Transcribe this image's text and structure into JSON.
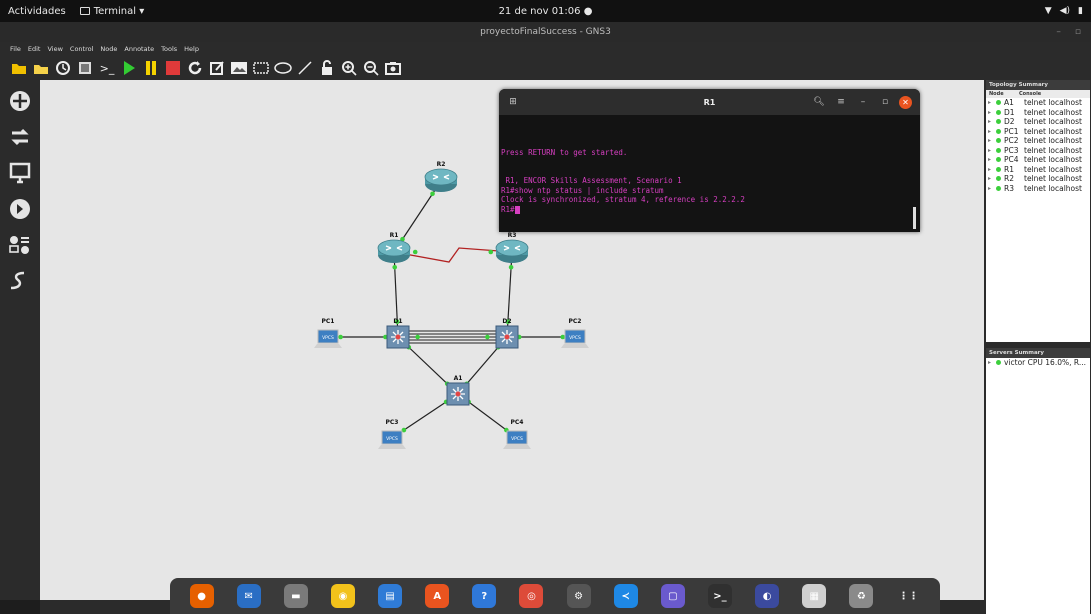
{
  "system_bar": {
    "activities": "Actividades",
    "app_menu": "Terminal ▾",
    "clock": "21 de nov 01:06  ●"
  },
  "window": {
    "title": "proyectoFinalSuccess - GNS3"
  },
  "menu": [
    "File",
    "Edit",
    "View",
    "Control",
    "Node",
    "Annotate",
    "Tools",
    "Help"
  ],
  "toolbar_icons": [
    "folder-icon",
    "open-icon",
    "snapshot-icon",
    "preferences-icon",
    "console-icon",
    "start-icon",
    "pause-icon",
    "stop-icon",
    "reload-icon",
    "note-icon",
    "image-icon",
    "rectangle-icon",
    "ellipse-icon",
    "line-icon",
    "lock-icon",
    "zoom-in-icon",
    "zoom-out-icon",
    "screenshot-icon"
  ],
  "sidebar_icons": [
    "routers-icon",
    "switches-icon",
    "end-devices-icon",
    "security-icon",
    "all-devices-icon",
    "add-link-icon"
  ],
  "topology": {
    "nodes": [
      {
        "id": "R2",
        "label": "R2",
        "type": "router"
      },
      {
        "id": "R1",
        "label": "R1",
        "type": "router"
      },
      {
        "id": "R3",
        "label": "R3",
        "type": "router"
      },
      {
        "id": "D1",
        "label": "D1",
        "type": "switch"
      },
      {
        "id": "D2",
        "label": "D2",
        "type": "switch"
      },
      {
        "id": "A1",
        "label": "A1",
        "type": "switch"
      },
      {
        "id": "PC1",
        "label": "PC1",
        "type": "vpcs"
      },
      {
        "id": "PC2",
        "label": "PC2",
        "type": "vpcs"
      },
      {
        "id": "PC3",
        "label": "PC3",
        "type": "vpcs"
      },
      {
        "id": "PC4",
        "label": "PC4",
        "type": "vpcs"
      }
    ],
    "links": [
      [
        "R1",
        "R2"
      ],
      [
        "R1",
        "R3"
      ],
      [
        "R1",
        "D1"
      ],
      [
        "R3",
        "D2"
      ],
      [
        "D1",
        "D2"
      ],
      [
        "D1",
        "A1"
      ],
      [
        "D2",
        "A1"
      ],
      [
        "PC1",
        "D1"
      ],
      [
        "PC2",
        "D2"
      ],
      [
        "PC3",
        "A1"
      ],
      [
        "PC4",
        "A1"
      ]
    ],
    "vpcs_label": "VPCS"
  },
  "terminal": {
    "title": "R1",
    "lines": [
      "",
      "",
      "",
      "Press RETURN to get started.",
      "",
      "",
      " R1, ENCOR Skills Assessment, Scenario 1",
      "R1#show ntp status | include stratum",
      "Clock is synchronized, stratum 4, reference is 2.2.2.2",
      "R1#"
    ]
  },
  "topology_summary": {
    "title": "Topology Summary",
    "col_node": "Node",
    "col_console": "Console",
    "rows": [
      {
        "node": "A1",
        "console": "telnet localhost"
      },
      {
        "node": "D1",
        "console": "telnet localhost"
      },
      {
        "node": "D2",
        "console": "telnet localhost"
      },
      {
        "node": "PC1",
        "console": "telnet localhost"
      },
      {
        "node": "PC2",
        "console": "telnet localhost"
      },
      {
        "node": "PC3",
        "console": "telnet localhost"
      },
      {
        "node": "PC4",
        "console": "telnet localhost"
      },
      {
        "node": "R1",
        "console": "telnet localhost"
      },
      {
        "node": "R2",
        "console": "telnet localhost"
      },
      {
        "node": "R3",
        "console": "telnet localhost"
      }
    ]
  },
  "servers_summary": {
    "title": "Servers Summary",
    "rows": [
      {
        "text": "victor CPU 16.0%, R..."
      }
    ]
  },
  "dock_apps": [
    {
      "name": "firefox-icon",
      "color": "#e66000",
      "glyph": "●"
    },
    {
      "name": "thunderbird-icon",
      "color": "#2a6ec4",
      "glyph": "✉"
    },
    {
      "name": "files-icon",
      "color": "#7a7a7a",
      "glyph": "▬"
    },
    {
      "name": "rhythmbox-icon",
      "color": "#f2c21b",
      "glyph": "◉"
    },
    {
      "name": "writer-icon",
      "color": "#2f7bd6",
      "glyph": "▤"
    },
    {
      "name": "software-icon",
      "color": "#e9541f",
      "glyph": "A"
    },
    {
      "name": "help-icon",
      "color": "#2f78d9",
      "glyph": "?"
    },
    {
      "name": "chrome-icon",
      "color": "#dd4b39",
      "glyph": "◎"
    },
    {
      "name": "settings-icon",
      "color": "#555555",
      "glyph": "⚙"
    },
    {
      "name": "vscode-icon",
      "color": "#1e88e5",
      "glyph": "≺"
    },
    {
      "name": "screenshot-app-icon",
      "color": "#6a5acd",
      "glyph": "▢"
    },
    {
      "name": "terminal-icon",
      "color": "#303030",
      "glyph": ">_"
    },
    {
      "name": "eclipse-icon",
      "color": "#3b4a9e",
      "glyph": "◐"
    },
    {
      "name": "document-icon",
      "color": "#cfcfcf",
      "glyph": "▦"
    },
    {
      "name": "trash-icon",
      "color": "#8a8a8a",
      "glyph": "♻"
    },
    {
      "name": "app-grid-icon",
      "color": "#3a3a3a",
      "glyph": "⋮⋮"
    }
  ]
}
